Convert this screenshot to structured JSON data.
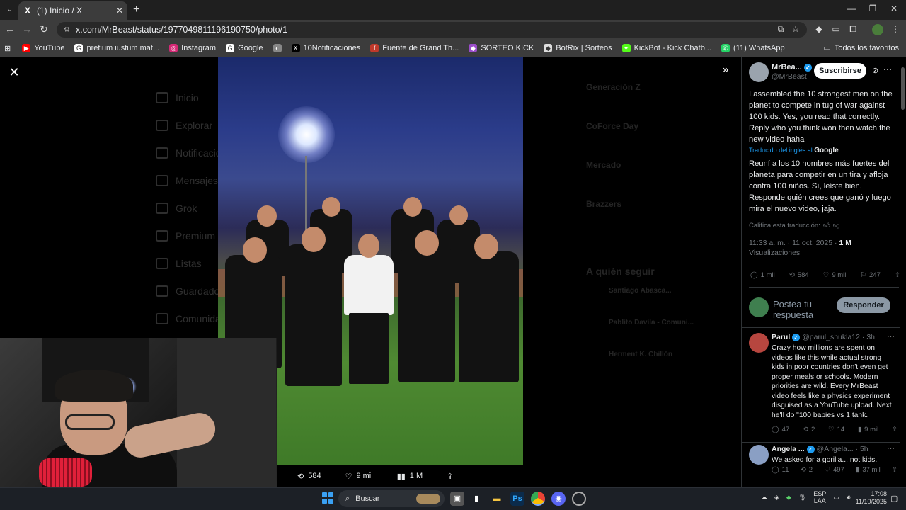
{
  "browser": {
    "tab_title": "(1) Inicio / X",
    "tab_favicon": "X",
    "url": "x.com/MrBeast/status/1977049811196190750/photo/1",
    "bookmarks": [
      {
        "label": "YouTube",
        "color": "#ff0000",
        "glyph": "▶"
      },
      {
        "label": "pretium iustum mat...",
        "color": "#ffffff",
        "glyph": "G"
      },
      {
        "label": "Instagram",
        "color": "#d62976",
        "glyph": "◎"
      },
      {
        "label": "Google",
        "color": "#ffffff",
        "glyph": "G"
      },
      {
        "label": "",
        "color": "#888888",
        "glyph": "◐"
      },
      {
        "label": "10Notificaciones",
        "color": "#000000",
        "glyph": "X"
      },
      {
        "label": "Fuente de Grand Th...",
        "color": "#c0392b",
        "glyph": "f"
      },
      {
        "label": "SORTEO KICK",
        "color": "#9b4dca",
        "glyph": "◆"
      },
      {
        "label": "BotRix | Sorteos",
        "color": "#dddddd",
        "glyph": "◆"
      },
      {
        "label": "KickBot - Kick Chatb...",
        "color": "#53fc18",
        "glyph": "✦"
      },
      {
        "label": "(11) WhatsApp",
        "color": "#25d366",
        "glyph": "✆"
      }
    ],
    "all_bookmarks_label": "Todos los favoritos"
  },
  "photo_viewer": {
    "actions": {
      "retweets": "584",
      "likes": "9 mil",
      "views": "1 M"
    }
  },
  "background_nav": [
    "Inicio",
    "Explorar",
    "Notificaciones",
    "Mensajes",
    "Grok",
    "Premium",
    "Listas",
    "Guardados",
    "Comunidades"
  ],
  "background_trends": [
    "Generación Z",
    "CoForce Day",
    "Mercado",
    "Brazzers"
  ],
  "background_follow_heading": "A quién seguir",
  "background_follow": [
    "Santiago Abasca...",
    "Pablito Davila - Comuni...",
    "Herment K. Chillón"
  ],
  "tweet": {
    "author_name": "MrBea...",
    "handle": "@MrBeast",
    "subscribe_label": "Suscribirse",
    "original_text": "I assembled the 10 strongest men on the planet to compete in tug of war against 100 kids. Yes, you read that correctly. Reply who you think won then watch the new video haha",
    "translated_by": "Traducido del inglés al",
    "translated_brand": "Google",
    "translated_text": "Reuní a los 10 hombres más fuertes del planeta para competir en un tira y afloja contra 100 niños. Sí, leíste bien. Responde quién crees que ganó y luego mira el nuevo video, jaja.",
    "rate_translation": "Califica esta traducción:",
    "timestamp": "11:33 a. m. · 11 oct. 2025 ·",
    "views_count": "1 M",
    "views_label": "Visualizaciones",
    "metrics": {
      "replies": "1 mil",
      "retweets": "584",
      "likes": "9 mil",
      "bookmarks": "247"
    },
    "reply_placeholder": "Postea tu respuesta",
    "reply_button": "Responder"
  },
  "replies": [
    {
      "name": "Parul",
      "handle": "@parul_shukla12 · 3h",
      "text": "Crazy how millions are spent on videos like this while actual strong kids in poor countries don't even get proper meals or schools. Modern priorities are wild. Every MrBeast video feels like a physics experiment disguised as a YouTube upload. Next he'll do \"100 babies vs 1 tank.",
      "metrics": {
        "replies": "47",
        "retweets": "2",
        "likes": "14",
        "views": "9 mil"
      },
      "avatar_color": "#b7463f"
    },
    {
      "name": "Angela ...",
      "handle": "@Angela... · 5h",
      "text": "We asked for a gorilla... not kids.",
      "metrics": {
        "replies": "11",
        "retweets": "2",
        "likes": "497",
        "views": "37 mil"
      },
      "avatar_color": "#8a9fc4"
    }
  ],
  "taskbar": {
    "search_label": "Buscar",
    "language": "ESP",
    "language_sub": "LAA",
    "time": "17:08",
    "date": "11/10/2025"
  }
}
